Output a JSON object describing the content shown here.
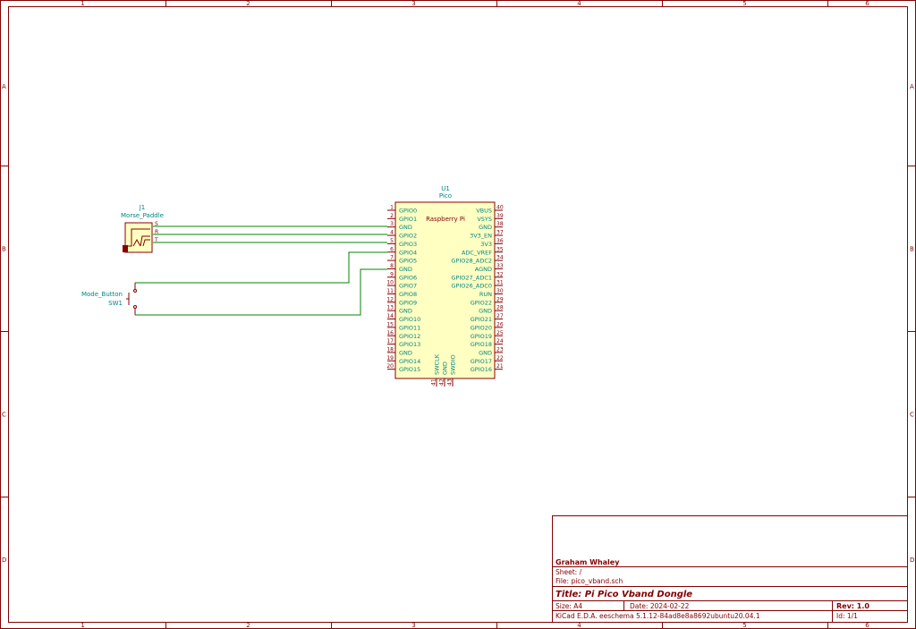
{
  "frame": {
    "columns": [
      "1",
      "2",
      "3",
      "4",
      "5",
      "6"
    ],
    "rows": [
      "A",
      "B",
      "C",
      "D"
    ]
  },
  "colors": {
    "frame": "#840000",
    "component": "#840000",
    "body_fill": "#ffffc2",
    "pin_text": "#008484",
    "ref_text": "#008484",
    "wire": "#008400",
    "title_text": "#840000"
  },
  "u1": {
    "ref": "U1",
    "value": "Pico",
    "body_label": "Raspberry Pi",
    "left_pins": [
      {
        "num": "1",
        "name": "GPIO0"
      },
      {
        "num": "2",
        "name": "GPIO1"
      },
      {
        "num": "3",
        "name": "GND"
      },
      {
        "num": "4",
        "name": "GPIO2"
      },
      {
        "num": "5",
        "name": "GPIO3"
      },
      {
        "num": "6",
        "name": "GPIO4"
      },
      {
        "num": "7",
        "name": "GPIO5"
      },
      {
        "num": "8",
        "name": "GND"
      },
      {
        "num": "9",
        "name": "GPIO6"
      },
      {
        "num": "10",
        "name": "GPIO7"
      },
      {
        "num": "11",
        "name": "GPIO8"
      },
      {
        "num": "12",
        "name": "GPIO9"
      },
      {
        "num": "13",
        "name": "GND"
      },
      {
        "num": "14",
        "name": "GPIO10"
      },
      {
        "num": "15",
        "name": "GPIO11"
      },
      {
        "num": "16",
        "name": "GPIO12"
      },
      {
        "num": "17",
        "name": "GPIO13"
      },
      {
        "num": "18",
        "name": "GND"
      },
      {
        "num": "19",
        "name": "GPIO14"
      },
      {
        "num": "20",
        "name": "GPIO15"
      }
    ],
    "right_pins": [
      {
        "num": "40",
        "name": "VBUS"
      },
      {
        "num": "39",
        "name": "VSYS"
      },
      {
        "num": "38",
        "name": "GND"
      },
      {
        "num": "37",
        "name": "3V3_EN"
      },
      {
        "num": "36",
        "name": "3V3"
      },
      {
        "num": "35",
        "name": "ADC_VREF"
      },
      {
        "num": "34",
        "name": "GPIO28_ADC2"
      },
      {
        "num": "33",
        "name": "AGND"
      },
      {
        "num": "32",
        "name": "GPIO27_ADC1"
      },
      {
        "num": "31",
        "name": "GPIO26_ADC0"
      },
      {
        "num": "30",
        "name": "RUN"
      },
      {
        "num": "29",
        "name": "GPIO22"
      },
      {
        "num": "28",
        "name": "GND"
      },
      {
        "num": "27",
        "name": "GPIO21"
      },
      {
        "num": "26",
        "name": "GPIO20"
      },
      {
        "num": "25",
        "name": "GPIO19"
      },
      {
        "num": "24",
        "name": "GPIO18"
      },
      {
        "num": "23",
        "name": "GND"
      },
      {
        "num": "22",
        "name": "GPIO17"
      },
      {
        "num": "21",
        "name": "GPIO16"
      }
    ],
    "bottom_pins": [
      {
        "num": "41",
        "name": "SWCLK"
      },
      {
        "num": "42",
        "name": "GND"
      },
      {
        "num": "43",
        "name": "SWDIO"
      }
    ]
  },
  "j1": {
    "ref": "J1",
    "value": "Morse_Paddle",
    "pins": [
      {
        "name": "S"
      },
      {
        "name": "R"
      },
      {
        "name": "T"
      }
    ]
  },
  "sw1": {
    "ref": "SW1",
    "value": "Mode_Button"
  },
  "title_block": {
    "company": "Graham Whaley",
    "sheet": "Sheet: /",
    "file": "File: pico_vband.sch",
    "title": "Title: Pi Pico Vband Dongle",
    "size": "Size: A4",
    "date": "Date: 2024-02-22",
    "rev": "Rev: 1.0",
    "tool": "KiCad E.D.A.  eeschema 5.1.12-84ad8e8a8692ubuntu20.04.1",
    "id": "Id: 1/1"
  }
}
